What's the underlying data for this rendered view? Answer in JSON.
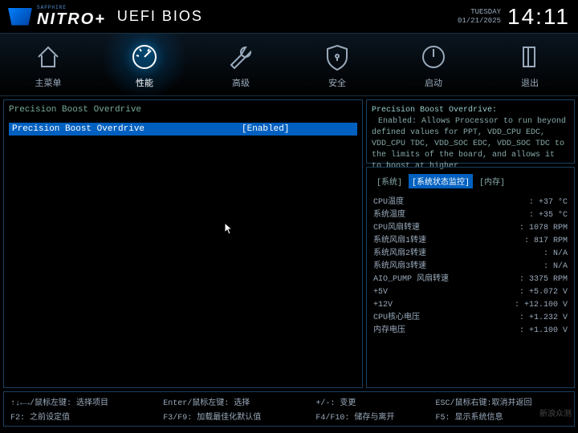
{
  "header": {
    "brand_sub": "SAPPHIRE",
    "brand": "NITRO+",
    "title": "UEFI BIOS",
    "day": "TUESDAY",
    "date": "01/21/2025",
    "time": "14:11"
  },
  "tabs": [
    {
      "label": "主菜单",
      "icon": "home"
    },
    {
      "label": "性能",
      "icon": "gauge"
    },
    {
      "label": "高级",
      "icon": "wrench"
    },
    {
      "label": "安全",
      "icon": "shield"
    },
    {
      "label": "启动",
      "icon": "power"
    },
    {
      "label": "退出",
      "icon": "exit"
    }
  ],
  "active_tab": 1,
  "left_panel": {
    "section": "Precision Boost Overdrive",
    "rows": [
      {
        "label": "Precision Boost Overdrive",
        "value": "[Enabled]",
        "selected": true
      }
    ]
  },
  "help": {
    "title": "Precision Boost Overdrive:",
    "body": "Enabled: Allows Processor to run beyond defined values for PPT, VDD_CPU EDC, VDD_CPU TDC, VDD_SOC EDC, VDD_SOC TDC to the limits of the board, and allows it to boost at higher"
  },
  "monitor": {
    "tabs": [
      "[系统]",
      "[系统状态监控]",
      "[内存]"
    ],
    "active": 1,
    "rows": [
      {
        "k": "CPU温度",
        "v": ": +37 °C"
      },
      {
        "k": "系统温度",
        "v": ": +35 °C"
      },
      {
        "k": "CPU风扇转速",
        "v": ": 1078 RPM"
      },
      {
        "k": "系统风扇1转速",
        "v": ": 817 RPM"
      },
      {
        "k": "系统风扇2转速",
        "v": ": N/A"
      },
      {
        "k": "系统风扇3转速",
        "v": ": N/A"
      },
      {
        "k": "AIO_PUMP 风扇转速",
        "v": ": 3375 RPM"
      },
      {
        "k": "+5V",
        "v": ": +5.072 V"
      },
      {
        "k": "+12V",
        "v": ": +12.100 V"
      },
      {
        "k": "CPU核心电压",
        "v": ": +1.232 V"
      },
      {
        "k": "内存电压",
        "v": ": +1.100 V"
      }
    ]
  },
  "footer": {
    "c1a": "↑↓←→/鼠标左键: 选择项目",
    "c1b": "F2: 之前设定值",
    "c2a": "Enter/鼠标左键: 选择",
    "c2b": "F3/F9: 加载最佳化默认值",
    "c3a": "+/-: 变更",
    "c3b": "F4/F10: 储存与离开",
    "c4a": "ESC/鼠标右键:取消并返回",
    "c4b": "F5: 显示系统信息"
  },
  "watermark": "新浪众测"
}
